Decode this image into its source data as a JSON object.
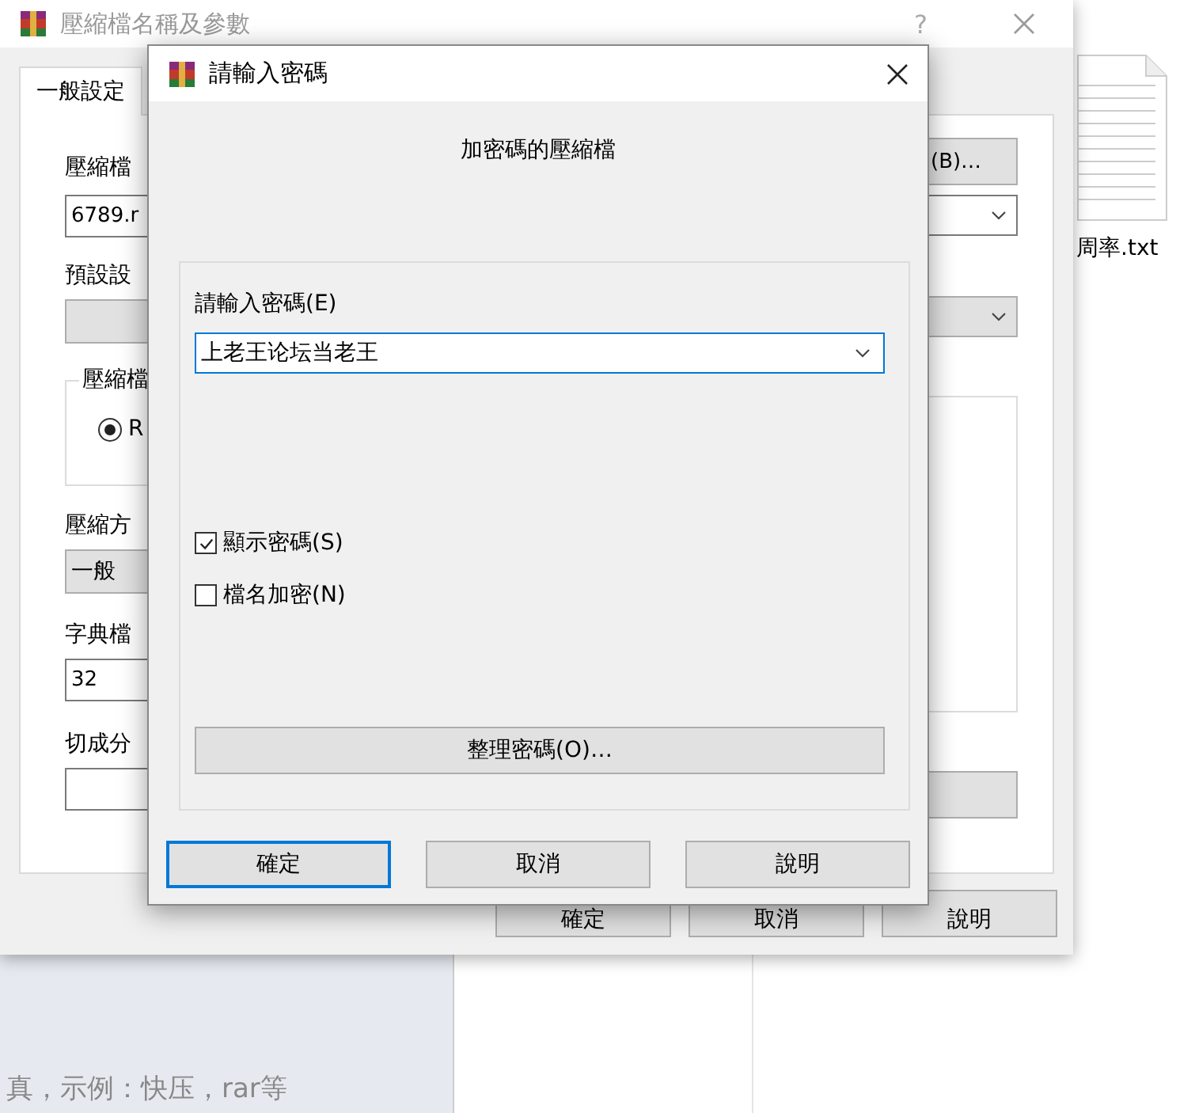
{
  "desktop": {
    "file_label": "周率.txt",
    "page_text": "真，示例：快压，rar等"
  },
  "back_window": {
    "title": "壓縮檔名稱及參數",
    "help": "?",
    "tabs": [
      {
        "label": "一般設定",
        "selected": true
      }
    ],
    "left_items": [
      {
        "kind": "label",
        "text": "壓縮檔"
      },
      {
        "kind": "input",
        "value": "6789.r"
      },
      {
        "kind": "label",
        "text": "預設設"
      },
      {
        "kind": "select"
      },
      {
        "kind": "group",
        "legend": "壓縮檔",
        "radio": {
          "label": "R",
          "selected": true
        }
      },
      {
        "kind": "label",
        "text": "壓縮方"
      },
      {
        "kind": "select",
        "value": "一般"
      },
      {
        "kind": "label",
        "text": "字典檔"
      },
      {
        "kind": "input",
        "value": "32"
      },
      {
        "kind": "label",
        "text": "切成分"
      },
      {
        "kind": "input"
      }
    ],
    "right_items": [
      {
        "kind": "button",
        "label": "(B)…"
      },
      {
        "kind": "combo"
      },
      {
        "kind": "select"
      },
      {
        "kind": "list"
      },
      {
        "kind": "button"
      }
    ],
    "buttons": [
      "確定",
      "取消",
      "說明"
    ]
  },
  "dialog": {
    "title": "請輸入密碼",
    "heading": "加密碼的壓縮檔",
    "password_label": "請輸入密碼(E)",
    "password_value": "上老王论坛当老王",
    "checkboxes": [
      {
        "label": "顯示密碼(S)",
        "checked": true
      },
      {
        "label": "檔名加密(N)",
        "checked": false
      }
    ],
    "manage_button": "整理密碼(O)…",
    "buttons": [
      {
        "label": "確定",
        "default": true
      },
      {
        "label": "取消",
        "default": false
      },
      {
        "label": "說明",
        "default": false
      }
    ]
  }
}
